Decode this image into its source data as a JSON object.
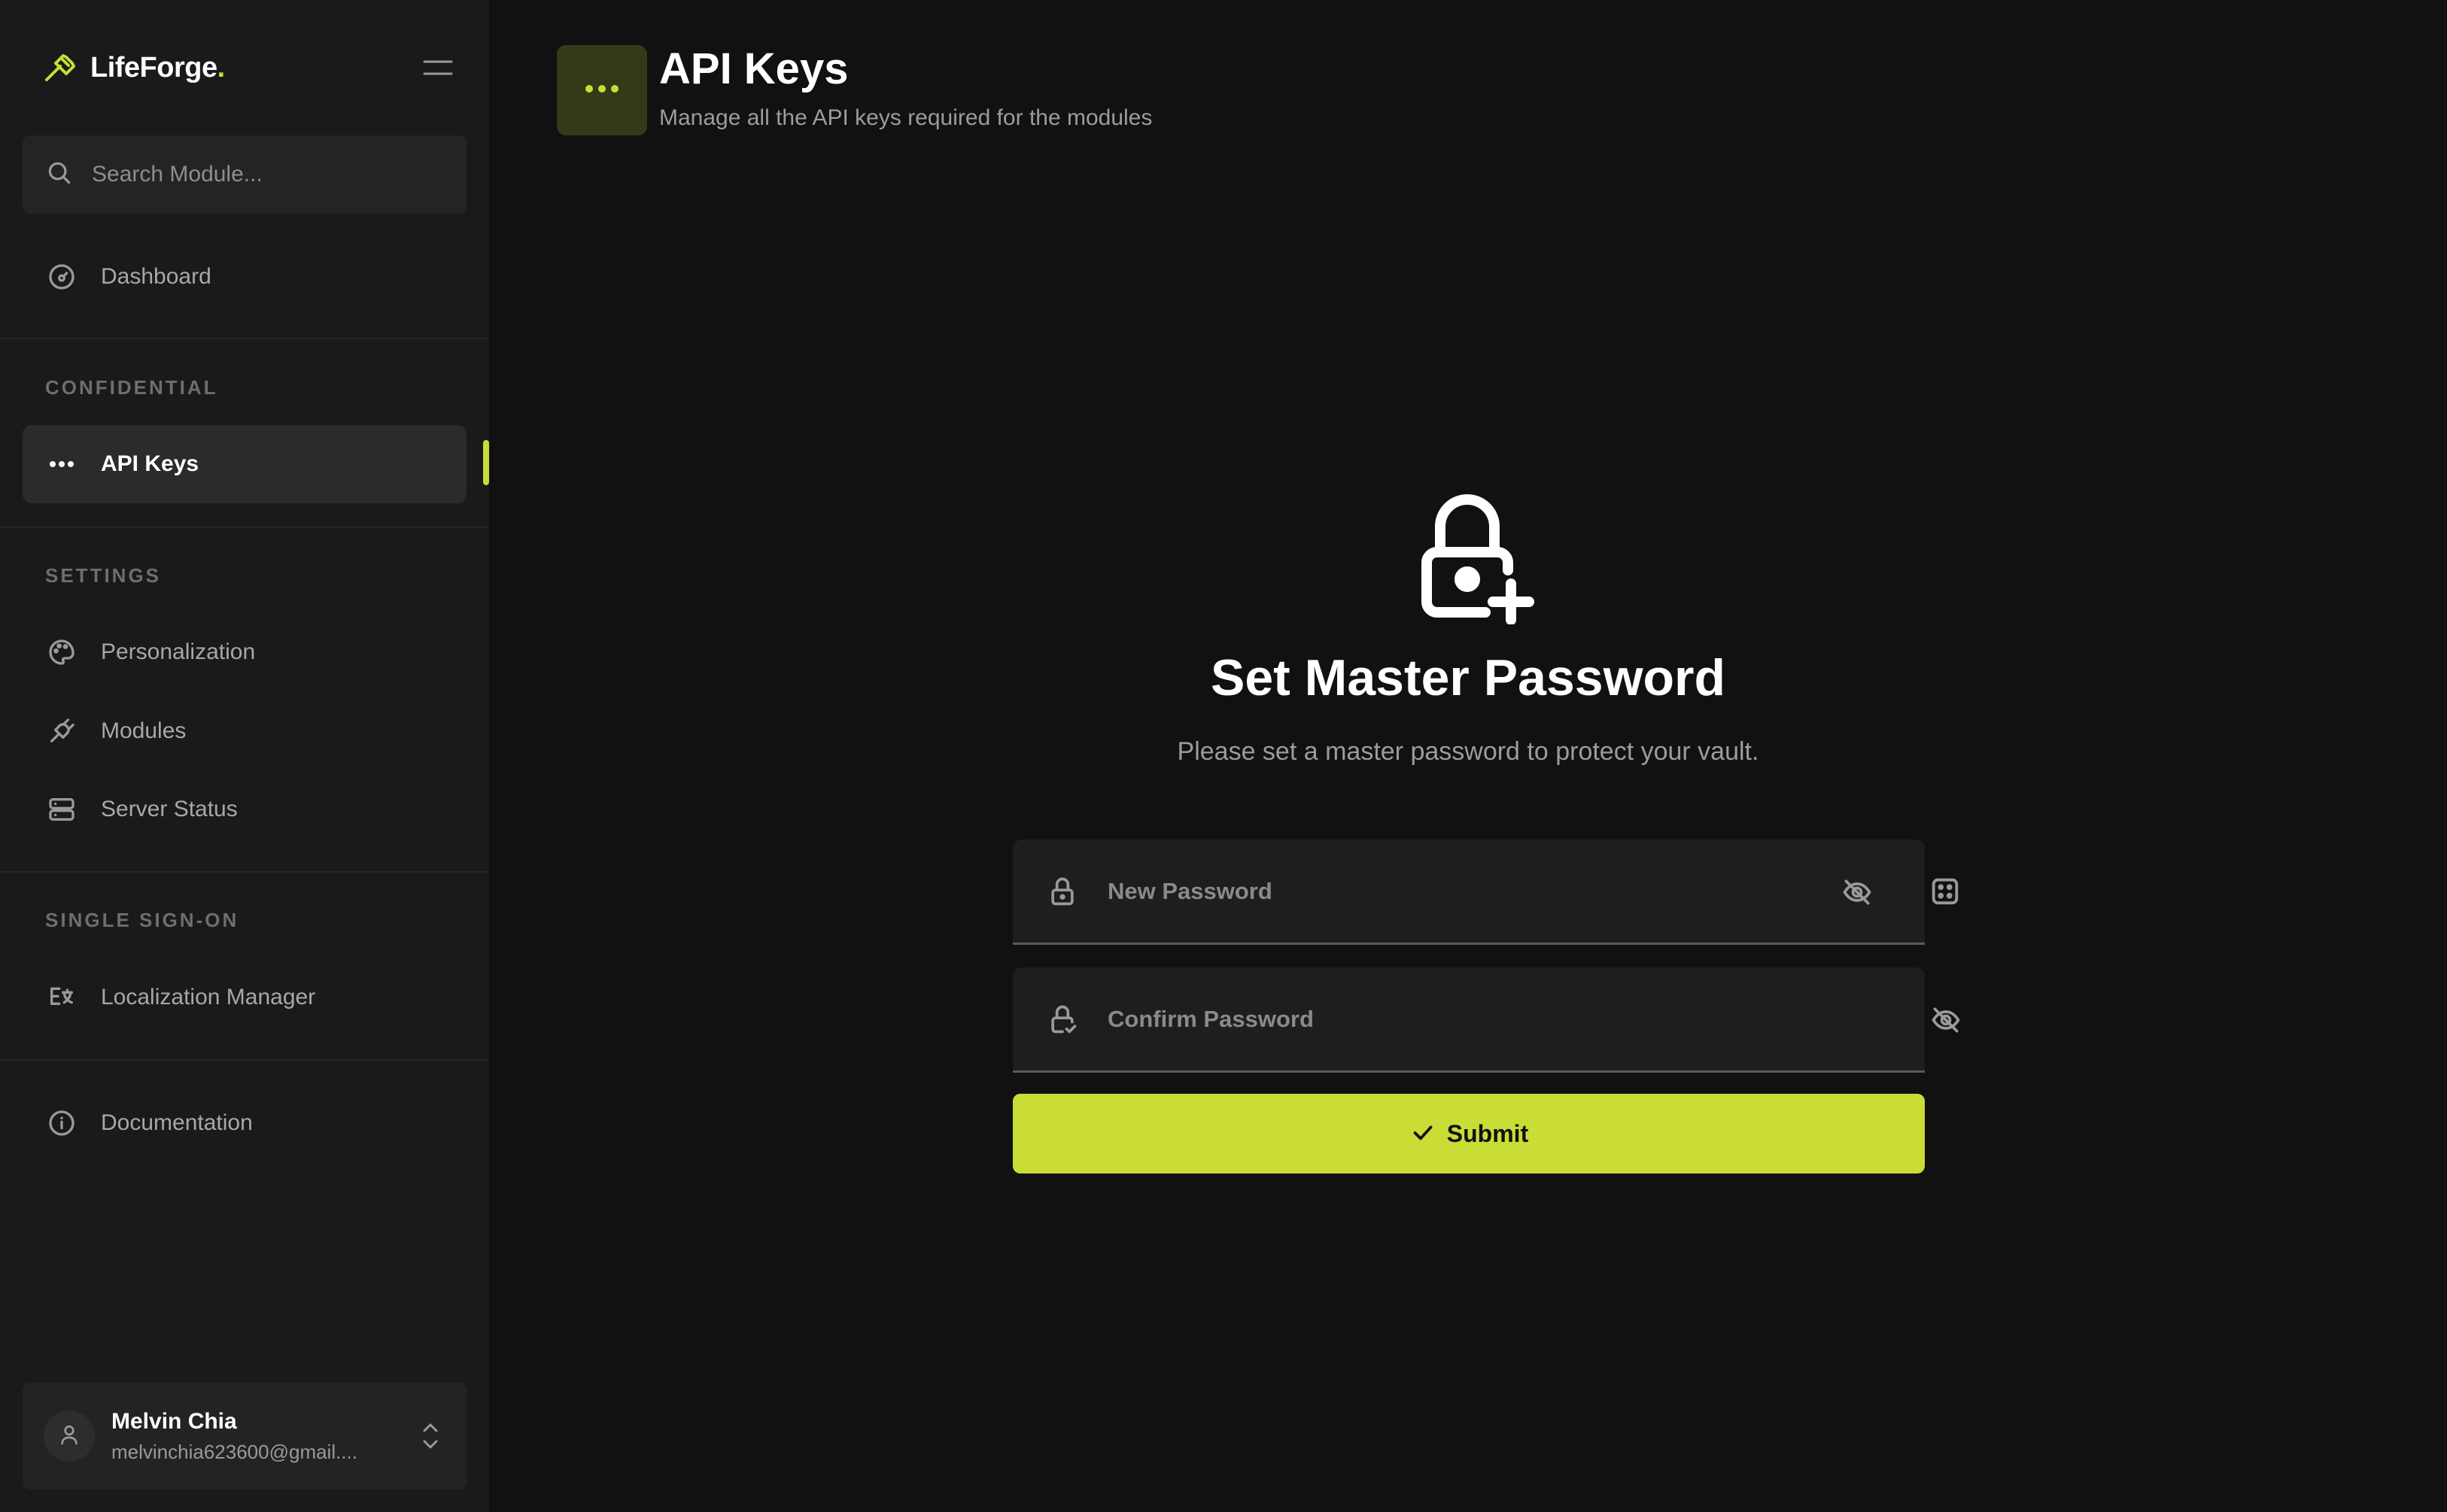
{
  "colors": {
    "accent": "#c9dd36",
    "background": "#111111",
    "sidebar": "#1a1a1a"
  },
  "brand": {
    "name": "LifeForge",
    "dot": "."
  },
  "search": {
    "placeholder": "Search Module..."
  },
  "sidebar": {
    "dashboard": {
      "label": "Dashboard",
      "icon": "dashboard-gauge-icon"
    },
    "sections": [
      {
        "title": "CONFIDENTIAL",
        "items": [
          {
            "label": "API Keys",
            "icon": "password-dots-icon",
            "active": true
          }
        ]
      },
      {
        "title": "SETTINGS",
        "items": [
          {
            "label": "Personalization",
            "icon": "palette-icon"
          },
          {
            "label": "Modules",
            "icon": "plug-icon"
          },
          {
            "label": "Server Status",
            "icon": "server-icon"
          }
        ]
      },
      {
        "title": "SINGLE SIGN-ON",
        "items": [
          {
            "label": "Localization Manager",
            "icon": "language-icon"
          }
        ]
      }
    ],
    "documentation": {
      "label": "Documentation",
      "icon": "info-circle-icon"
    }
  },
  "user": {
    "name": "Melvin Chia",
    "email": "melvinchia623600@gmail...."
  },
  "header": {
    "title": "API Keys",
    "subtitle": "Manage all the API keys required for the modules",
    "icon": "password-dots-icon"
  },
  "setup": {
    "title": "Set Master Password",
    "description": "Please set a master password to protect your vault.",
    "new_password_placeholder": "New Password",
    "confirm_password_placeholder": "Confirm Password",
    "submit_label": "Submit"
  }
}
